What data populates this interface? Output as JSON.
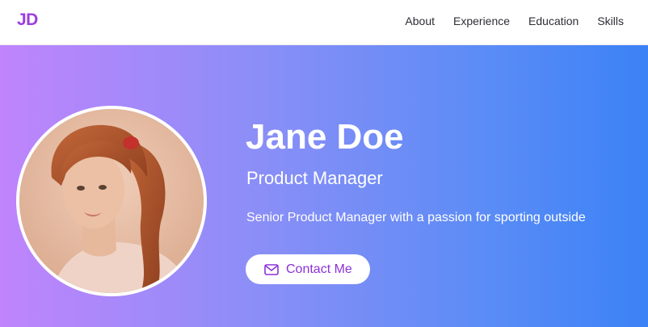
{
  "nav": {
    "logo": "JD",
    "links": [
      {
        "label": "About"
      },
      {
        "label": "Experience"
      },
      {
        "label": "Education"
      },
      {
        "label": "Skills"
      }
    ]
  },
  "hero": {
    "name": "Jane Doe",
    "role": "Product Manager",
    "bio": "Senior Product Manager with a passion for sporting outside",
    "contact_label": "Contact Me",
    "contact_icon": "mail-icon",
    "avatar_icon": "profile-photo"
  },
  "colors": {
    "brand": "#9b3fe0",
    "gradient_start": "#c084fc",
    "gradient_end": "#3b82f6",
    "button_text": "#8b32d9"
  }
}
